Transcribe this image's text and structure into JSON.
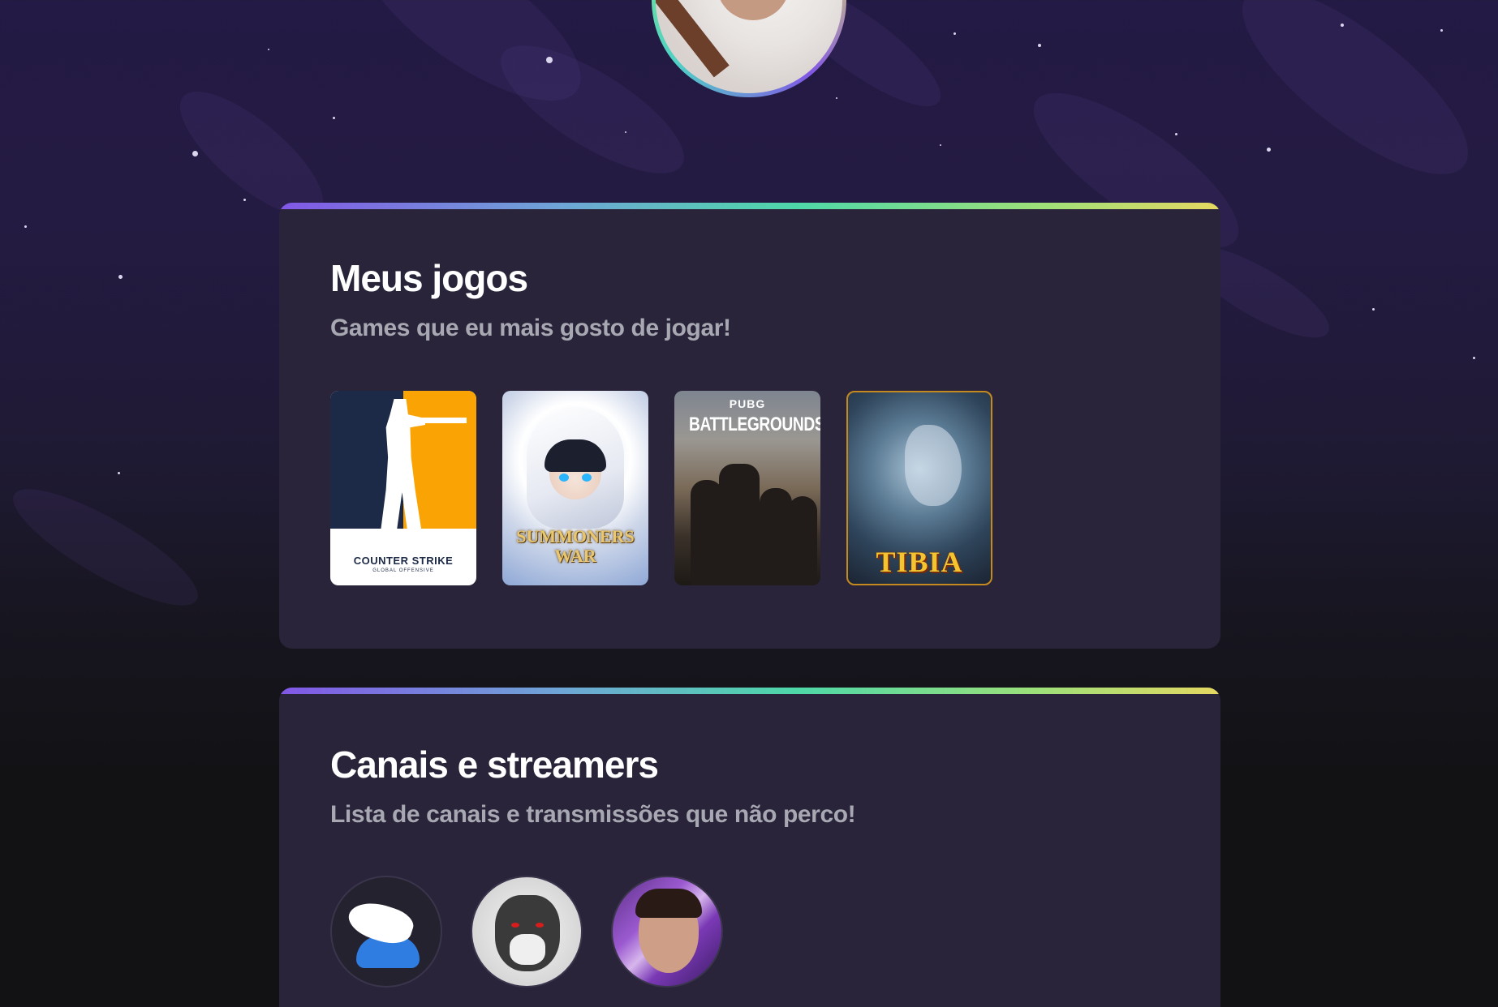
{
  "profile": {
    "avatar_alt": "Foto de perfil"
  },
  "games_section": {
    "title": "Meus jogos",
    "subtitle": "Games que eu mais gosto de jogar!",
    "games": [
      {
        "name": "Counter-Strike",
        "logo_text": "COUNTER STRIKE",
        "logo_sub": "GLOBAL OFFENSIVE"
      },
      {
        "name": "Summoners War",
        "logo_text": "SUMMONERS WAR"
      },
      {
        "name": "PUBG Battlegrounds",
        "logo_small": "PUBG",
        "logo_text": "BATTLEGROUNDS"
      },
      {
        "name": "Tibia",
        "logo_text": "TIBIA"
      }
    ]
  },
  "channels_section": {
    "title": "Canais e streamers",
    "subtitle": "Lista de canais e transmissões que não perco!",
    "channels": [
      {
        "icon": "winged-helmet-icon"
      },
      {
        "icon": "tiger-icon"
      },
      {
        "icon": "streamer-avatar"
      }
    ]
  },
  "theme": {
    "accent_gradient": [
      "#8257e6",
      "#4ed8a8",
      "#e5d861"
    ],
    "card_background": "#29243a",
    "title_color": "#ffffff",
    "subtitle_color": "#a8a8b3"
  }
}
